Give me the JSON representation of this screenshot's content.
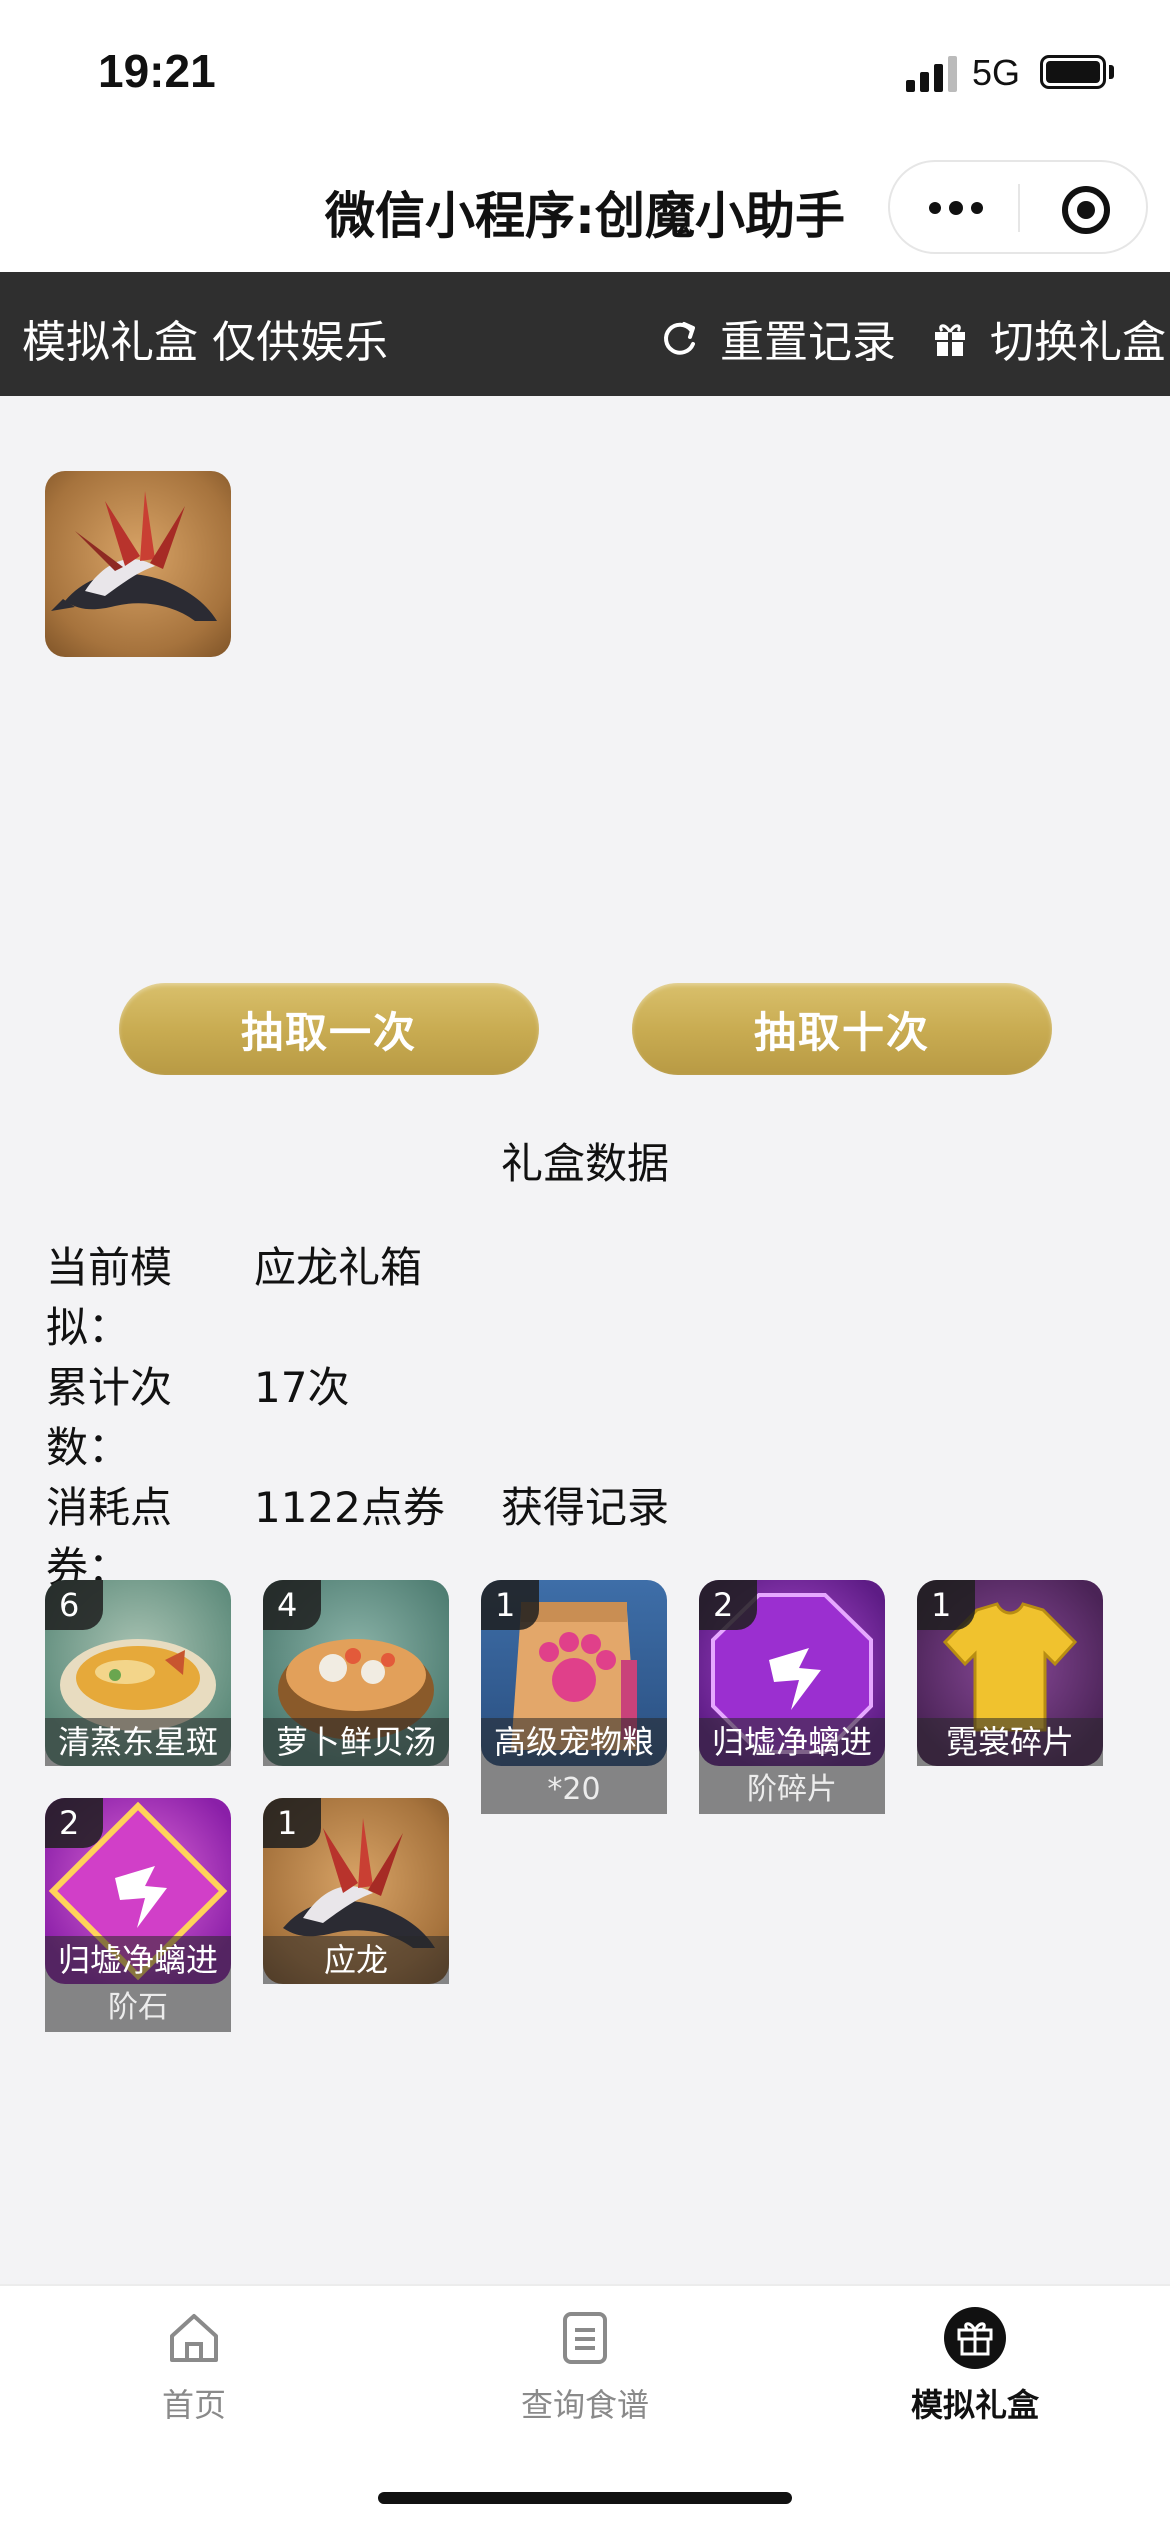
{
  "status_bar": {
    "time": "19:21",
    "network": "5G"
  },
  "header": {
    "title": "微信小程序:创魔小助手"
  },
  "toolbar": {
    "left_text": "模拟礼盒 仅供娱乐",
    "reset_label": "重置记录",
    "switch_label": "切换礼盒"
  },
  "draw": {
    "one_label": "抽取一次",
    "ten_label": "抽取十次"
  },
  "stats": {
    "title": "礼盒数据",
    "current_label": "当前模拟：",
    "current_value": "应龙礼箱",
    "count_label": "累计次数：",
    "count_value": "17次",
    "cost_label": "消耗点券：",
    "cost_value": "1122点券"
  },
  "records": {
    "title": "获得记录",
    "items": [
      {
        "count": "6",
        "name": "清蒸东星斑",
        "name2": "",
        "kind": "dish-fish"
      },
      {
        "count": "4",
        "name": "萝卜鲜贝汤",
        "name2": "",
        "kind": "dish-soup"
      },
      {
        "count": "1",
        "name": "高级宠物粮",
        "name2": "*20",
        "kind": "pet-food"
      },
      {
        "count": "2",
        "name": "归墟净螭进",
        "name2": "阶碎片",
        "kind": "crystal-shard"
      },
      {
        "count": "1",
        "name": "霓裳碎片",
        "name2": "",
        "kind": "shirt-shard"
      },
      {
        "count": "2",
        "name": "归墟净螭进",
        "name2": "阶石",
        "kind": "crystal-stone"
      },
      {
        "count": "1",
        "name": "应龙",
        "name2": "",
        "kind": "dragon"
      }
    ]
  },
  "tabbar": {
    "items": [
      {
        "label": "首页",
        "icon": "home-icon"
      },
      {
        "label": "查询食谱",
        "icon": "recipe-icon"
      },
      {
        "label": "模拟礼盒",
        "icon": "gift-icon"
      }
    ],
    "active_index": 2
  }
}
